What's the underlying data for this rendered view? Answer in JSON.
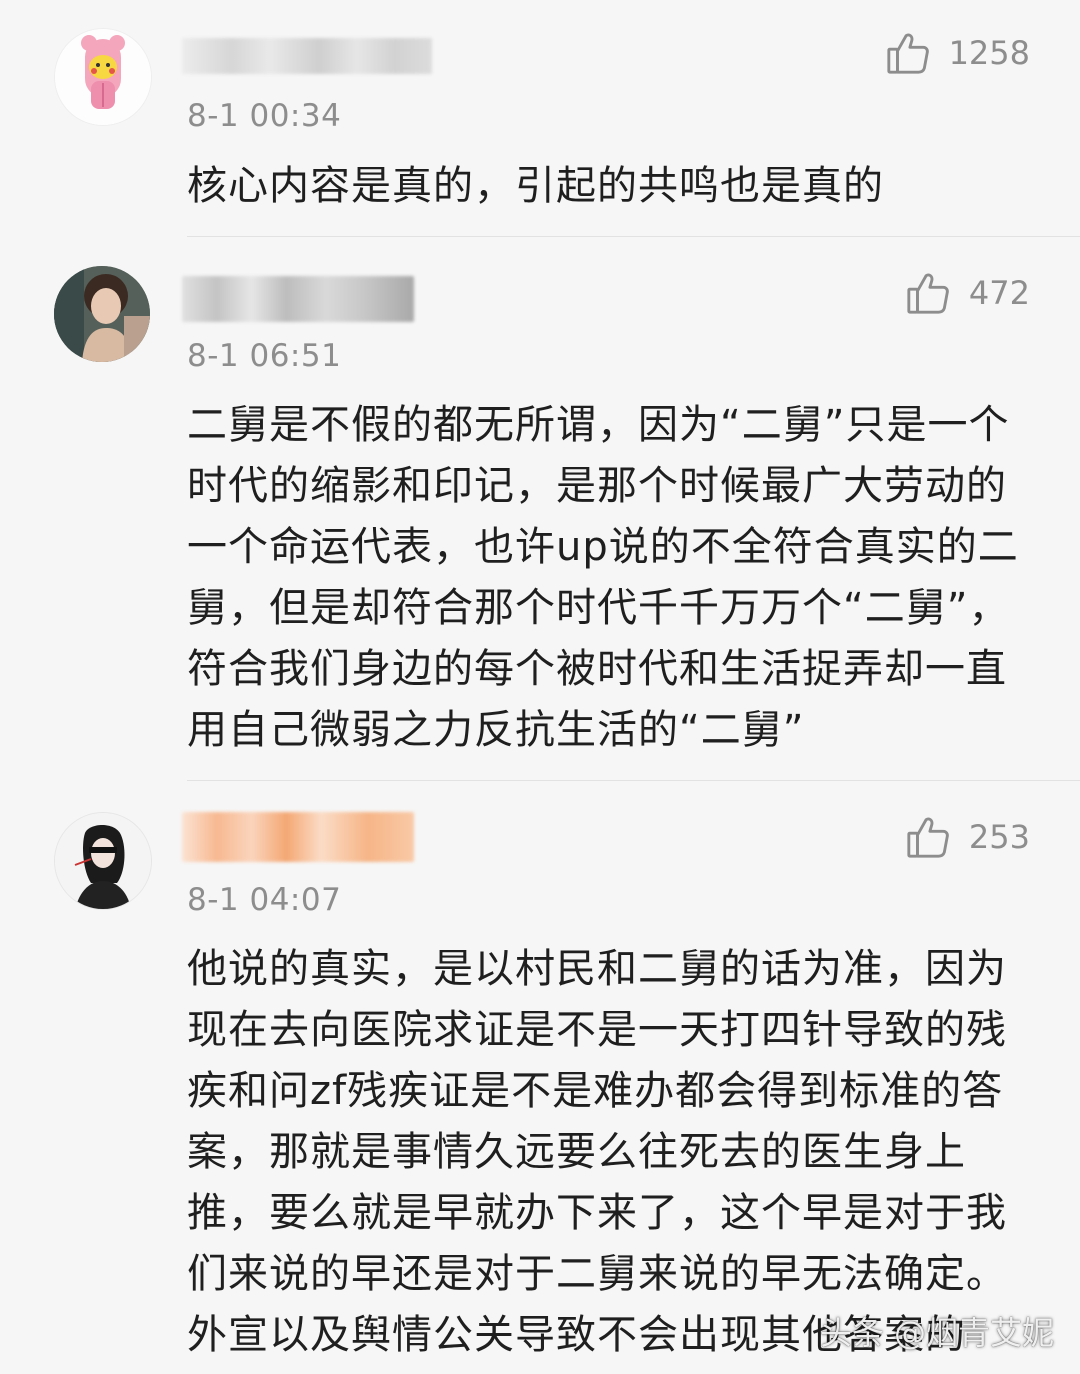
{
  "comments": [
    {
      "username_blurred": true,
      "time": "8-1 00:34",
      "likes": "1258",
      "text": "核心内容是真的，引起的共鸣也是真的"
    },
    {
      "username_blurred": true,
      "time": "8-1 06:51",
      "likes": "472",
      "text": "二舅是不假的都无所谓，因为“二舅”只是一个时代的缩影和印记，是那个时候最广大劳动的一个命运代表，也许up说的不全符合真实的二舅，但是却符合那个时代千千万万个“二舅”，符合我们身边的每个被时代和生活捉弄却一直用自己微弱之力反抗生活的“二舅”"
    },
    {
      "username_blurred": true,
      "time": "8-1 04:07",
      "likes": "253",
      "text": "他说的真实，是以村民和二舅的话为准，因为现在去向医院求证是不是一天打四针导致的残疾和问zf残疾证是不是难办都会得到标准的答案，那就是事情久远要么往死去的医生身上推，要么就是早就办下来了，这个早是对于我们来说的早还是对于二舅来说的早无法确定。外宣以及舆情公关导致不会出现其他答案的"
    }
  ],
  "watermark": "头条 @烟青艾妮",
  "colors": {
    "background": "#f6f6f6",
    "meta_text": "#8d8d8d",
    "body_text": "#1f1f1f"
  },
  "icons": [
    "thumbs-up-icon"
  ]
}
